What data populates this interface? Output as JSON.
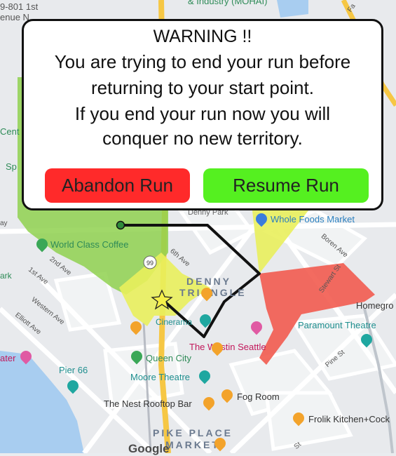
{
  "map": {
    "colors": {
      "water": "#a8cdf0",
      "territory_green": "#8fd14f",
      "territory_yellow": "#e9ef5c",
      "territory_red": "#f25b4f",
      "route": "#111111",
      "highway": "#f6c744"
    },
    "labels": {
      "top_left_address": "9-801 1st",
      "top_left_street": "enue N",
      "top_center": "& Industry (MOHAI)",
      "left_edge_1": "Cent",
      "left_edge_2": "Sp",
      "left_edge_3": "ark",
      "left_edge_4": "ater",
      "left_edge_5": "ay",
      "denny_park": "Denny Park",
      "whole_foods": "Whole Foods Market",
      "world_class_coffee": "World Class Coffee",
      "denny_triangle_1": "DENNY",
      "denny_triangle_2": "TRIANGLE",
      "cinerama": "Cinerama",
      "westin": "The Westin Seattle",
      "paramount": "Paramount Theatre",
      "homegro": "Homegro",
      "queen_city": "Queen City",
      "pier66": "Pier 66",
      "moore": "Moore Theatre",
      "nest": "The Nest Rooftop Bar",
      "fog_room": "Fog Room",
      "frolik": "Frolik Kitchen+Cock",
      "pike_place_1": "PIKE PLACE",
      "pike_place_2": "MARKET",
      "google": "Google",
      "route_99": "99"
    },
    "streets": {
      "2nd_ave": "2nd Ave",
      "1st_ave": "1st Ave",
      "western_ave": "Western Ave",
      "elliott_ave": "Elliott Ave",
      "6th_ave": "6th Ave",
      "boren_ave": "Boren Ave",
      "stewart_st": "Stewart St",
      "pine_st": "Pine St",
      "fa": "Fa",
      "st_bottom": "St"
    }
  },
  "dialog": {
    "title": "WARNING !!",
    "line1": "You are trying to end your run before",
    "line2": "returning to your start point.",
    "line3": "If you end your run now you will",
    "line4": "conquer no new territory.",
    "abandon_label": "Abandon Run",
    "resume_label": "Resume Run"
  }
}
